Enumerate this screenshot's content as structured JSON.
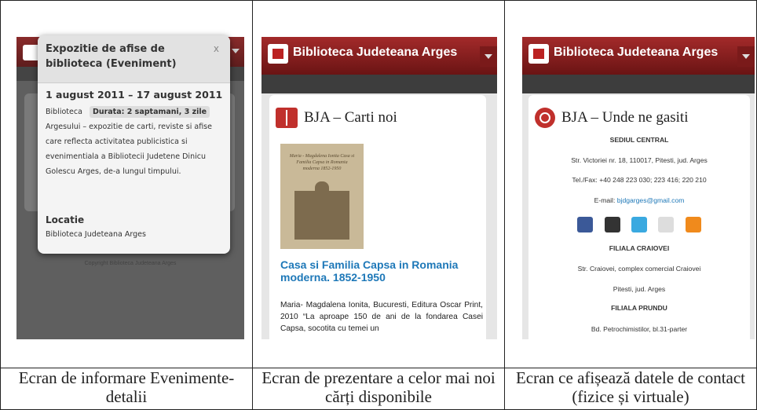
{
  "captions": [
    "Ecran de informare Evenimente-detalii",
    "Ecran de prezentare a celor mai noi cărți disponibile",
    "Ecran ce afișează datele de contact (fizice și virtuale)"
  ],
  "screen1": {
    "popup_title": "Expozitie de afise de biblioteca (Eveniment)",
    "close_label": "x",
    "date_range": "1 august 2011 – 17 august 2011",
    "description_start": "Biblioteca",
    "duration_badge": "Durata: 2 saptamani, 3 zile",
    "description_rest": "Argesului – expozitie de carti, reviste si afise care reflecta activitatea publicistica si evenimentiala a Bibliotecii Judetene Dinicu Golescu Arges, de-a lungul timpului.",
    "location_heading": "Locatie",
    "location_value": "Biblioteca Judeteana Arges",
    "footer_copyright": "Copyright Biblioteca Judeteana Arges"
  },
  "screen2": {
    "app_title": "Biblioteca Judeteana Arges",
    "section_title": "BJA – Carti noi",
    "cover_text": "Maria - Magdalena Ionita Casa si Familia Capsa in Romania moderna 1852-1950",
    "book_title": "Casa si Familia Capsa in Romania moderna. 1852-1950",
    "book_description": "Maria- Magdalena Ionita, Bucuresti, Editura Oscar Print, 2010 “La aproape 150 de ani de la fondarea Casei Capsa, socotita cu temei un"
  },
  "screen3": {
    "app_title": "Biblioteca Judeteana Arges",
    "section_title": "BJA – Unde ne gasiti",
    "hq_heading": "SEDIUL CENTRAL",
    "hq_address": "Str. Victoriei nr. 18, 110017, Pitesti, jud. Arges",
    "hq_phone": "Tel./Fax: +40 248 223 030; 223 416; 220 210",
    "email_label": "E-mail: ",
    "email_value": "bjdgarges@gmail.com",
    "social_icons": [
      "facebook-icon",
      "plus-icon",
      "twitter-icon",
      "flickr-icon",
      "rss-icon"
    ],
    "branch1_heading": "FILIALA CRAIOVEI",
    "branch1_address_1": "Str. Craiovei, complex comercial Craiovei",
    "branch1_address_2": "Pitesti, jud. Arges",
    "branch2_heading": "FILIALA PRUNDU",
    "branch2_address": "Bd. Petrochimistilor, bl.31-parter"
  },
  "colors": {
    "brand_red": "#a32a2a",
    "link_blue": "#1e78b8"
  }
}
